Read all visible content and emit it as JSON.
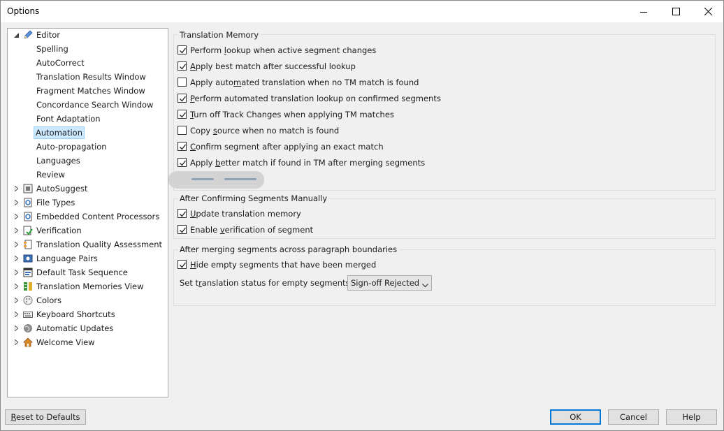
{
  "window": {
    "title": "Options"
  },
  "tree": {
    "editor": {
      "label": "Editor",
      "expanded": true,
      "children": [
        "Spelling",
        "AutoCorrect",
        "Translation Results Window",
        "Fragment Matches Window",
        "Concordance Search Window",
        "Font Adaptation",
        "Automation",
        "Auto-propagation",
        "Languages",
        "Review"
      ],
      "selected": "Automation"
    },
    "others": [
      {
        "label": "AutoSuggest",
        "icon": "autosuggest-icon"
      },
      {
        "label": "File Types",
        "icon": "file-types-icon"
      },
      {
        "label": "Embedded Content Processors",
        "icon": "embedded-content-icon"
      },
      {
        "label": "Verification",
        "icon": "verification-icon"
      },
      {
        "label": "Translation Quality Assessment",
        "icon": "quality-assessment-icon"
      },
      {
        "label": "Language Pairs",
        "icon": "language-pairs-icon"
      },
      {
        "label": "Default Task Sequence",
        "icon": "task-sequence-icon"
      },
      {
        "label": "Translation Memories View",
        "icon": "translation-memories-icon"
      },
      {
        "label": "Colors",
        "icon": "palette-icon"
      },
      {
        "label": "Keyboard Shortcuts",
        "icon": "keyboard-icon"
      },
      {
        "label": "Automatic Updates",
        "icon": "globe-icon"
      },
      {
        "label": "Welcome View",
        "icon": "home-icon"
      }
    ]
  },
  "translation_memory": {
    "title": "Translation Memory",
    "options": [
      {
        "pre": "Perform ",
        "u": "l",
        "post": "ookup when active segment changes",
        "checked": true
      },
      {
        "pre": "",
        "u": "A",
        "post": "pply best match after successful lookup",
        "checked": true
      },
      {
        "pre": "Apply auto",
        "u": "m",
        "post": "ated translation when no TM match is found",
        "checked": false
      },
      {
        "pre": "",
        "u": "P",
        "post": "erform automated translation lookup on confirmed segments",
        "checked": true
      },
      {
        "pre": "",
        "u": "T",
        "post": "urn off Track Changes when applying TM matches",
        "checked": true
      },
      {
        "pre": "Copy ",
        "u": "s",
        "post": "ource when no match is found",
        "checked": false
      },
      {
        "pre": "",
        "u": "C",
        "post": "onfirm segment after applying an exact match",
        "checked": true
      },
      {
        "pre": "Apply ",
        "u": "b",
        "post": "etter match if found in TM after merging segments",
        "checked": true
      }
    ]
  },
  "after_confirming": {
    "title": "After Confirming Segments Manually",
    "options": [
      {
        "pre": "",
        "u": "U",
        "post": "pdate translation memory",
        "checked": true
      },
      {
        "pre": "Enable ",
        "u": "v",
        "post": "erification of segment",
        "checked": true
      }
    ]
  },
  "after_merging": {
    "title": "After merging segments across paragraph boundaries",
    "options": [
      {
        "pre": "",
        "u": "H",
        "post": "ide empty segments that have been merged",
        "checked": true
      }
    ],
    "status_label_pre": "Set t",
    "status_label_u": "r",
    "status_label_post": "anslation status for empty segments to:",
    "status_value": "Sign-off Rejected"
  },
  "buttons": {
    "reset_pre": "",
    "reset_u": "R",
    "reset_post": "eset to Defaults",
    "ok": "OK",
    "cancel": "Cancel",
    "help": "Help"
  }
}
